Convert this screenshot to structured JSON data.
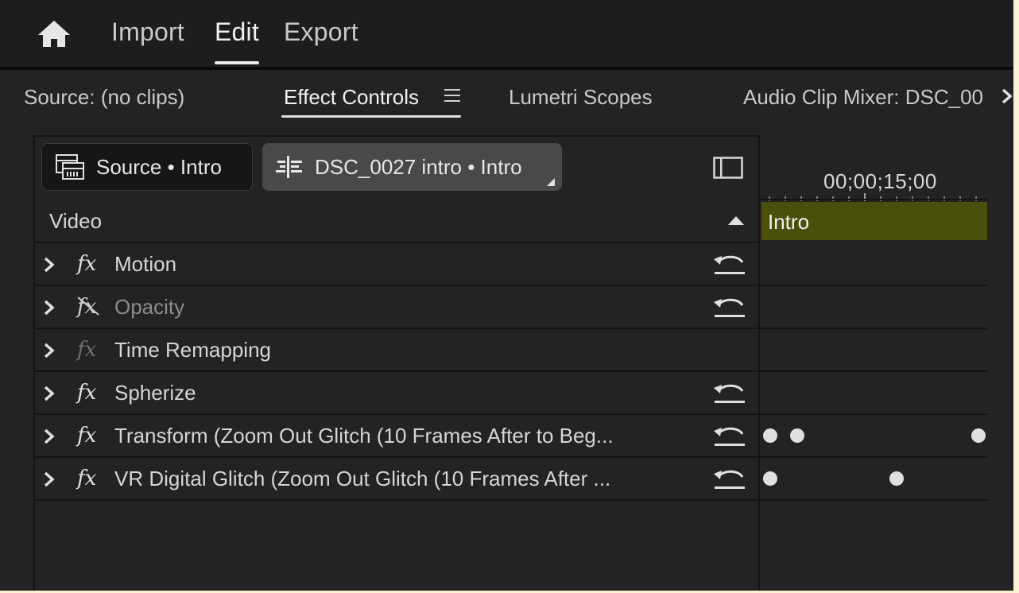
{
  "nav": {
    "home_icon": "home-icon",
    "items": [
      "Import",
      "Edit",
      "Export"
    ],
    "active": "Edit"
  },
  "tabs": {
    "items": [
      "Source: (no clips)",
      "Effect Controls",
      "Lumetri Scopes",
      "Audio Clip Mixer: DSC_00"
    ],
    "active": "Effect Controls"
  },
  "clips": {
    "source_label": "Source • Intro",
    "sequence_label": "DSC_0027 intro • Intro"
  },
  "timeline": {
    "timecode": "00;00;15;00",
    "clip_name": "Intro"
  },
  "video_section": "Video",
  "effects": [
    {
      "name": "Motion",
      "enabled": true,
      "reset": true,
      "keyframes": []
    },
    {
      "name": "Opacity",
      "enabled": false,
      "reset": true,
      "keyframes": []
    },
    {
      "name": "Time Remapping",
      "enabled": true,
      "fx_dim": true,
      "reset": false,
      "keyframes": []
    },
    {
      "name": "Spherize",
      "enabled": true,
      "reset": true,
      "keyframes": []
    },
    {
      "name": "Transform (Zoom Out Glitch (10 Frames After to Beg...",
      "enabled": true,
      "reset": true,
      "keyframes": [
        0.04,
        0.16,
        0.96
      ]
    },
    {
      "name": "VR Digital Glitch (Zoom Out Glitch (10 Frames After ...",
      "enabled": true,
      "reset": true,
      "keyframes": [
        0.04,
        0.6
      ]
    }
  ],
  "colors": {
    "panel_bg": "#232323",
    "clip_bar": "#4b4f0c"
  }
}
